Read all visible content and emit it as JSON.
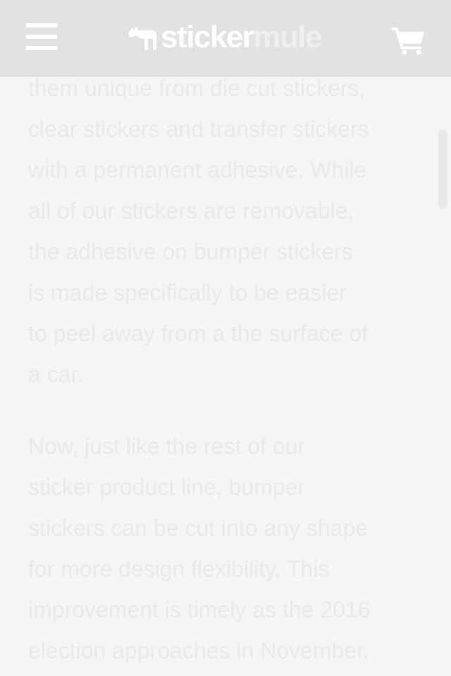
{
  "header": {
    "logo_primary": "sticker",
    "logo_secondary": "mule",
    "menu_icon": "hamburger-icon",
    "cart_icon": "shopping-cart-icon"
  },
  "article": {
    "paragraph_1": [
      "them unique from die cut stickers,",
      "clear stickers and transfer stickers",
      "with a permanent adhesive. While",
      "all of our stickers are removable,",
      "the adhesive on bumper stickers",
      "is made specifically to be easier",
      "to peel away from a the surface of",
      "a car."
    ],
    "paragraph_2": [
      "Now, just like the rest of our",
      "sticker product line, bumper",
      "stickers can be cut into any shape",
      "for more design flexibility. This",
      "improvement is timely as the 2016",
      "election approaches in November."
    ]
  },
  "colors": {
    "header_bg": "#e2e2e2",
    "page_bg": "#f5f5f5",
    "text": "#e9e9e9",
    "logo_white": "#ffffff"
  }
}
